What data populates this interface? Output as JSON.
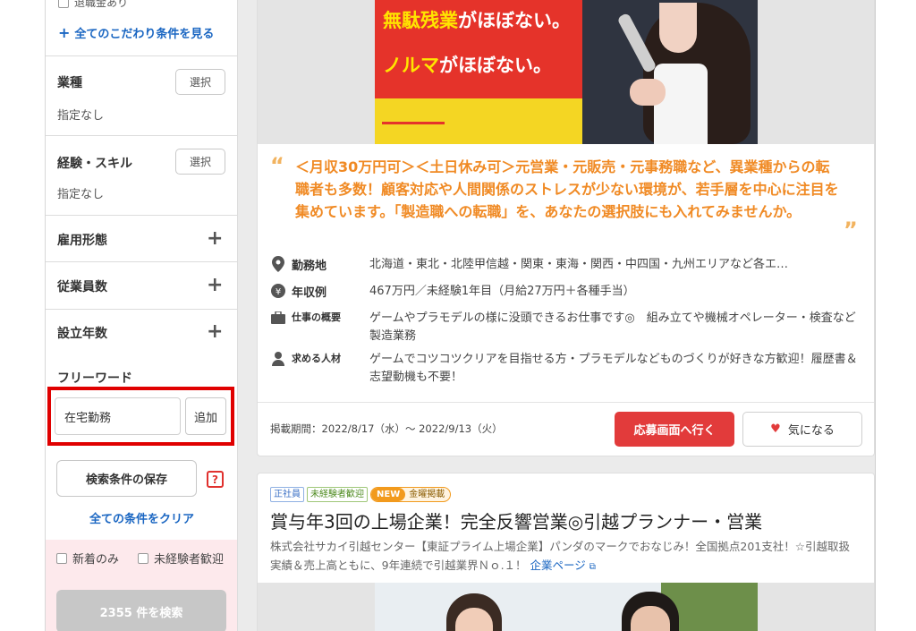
{
  "sidebar": {
    "partial_option": "退職金あり",
    "more_conditions": "全てのこだわり条件を見る",
    "industry": {
      "label": "業種",
      "value": "指定なし",
      "button": "選択"
    },
    "experience": {
      "label": "経験・スキル",
      "value": "指定なし",
      "button": "選択"
    },
    "employment_type": "雇用形態",
    "employees": "従業員数",
    "founded": "設立年数",
    "freeword": {
      "label": "フリーワード",
      "value": "在宅勤務",
      "add": "追加"
    },
    "save": "検索条件の保存",
    "help": "?",
    "clear": "全ての条件をクリア",
    "new_only": "新着のみ",
    "inexperienced": "未経験者歓迎",
    "search_button": "2355 件を検索"
  },
  "card1": {
    "banner_line1_a": "無駄残業",
    "banner_line1_b": "がほぼない。",
    "banner_line2_a": "ノルマ",
    "banner_line2_b": "がほぼない。",
    "catch": "＜月収30万円可＞＜土日休み可＞元営業・元販売・元事務職など、異業種からの転職者も多数！顧客対応や人間関係のストレスが少ない環境が、若手層を中心に注目を集めています。「製造職への転職」を、あなたの選択肢にも入れてみませんか。",
    "location_label": "勤務地",
    "location": "北海道・東北・北陸甲信越・関東・東海・関西・中四国・九州エリアなど各エ…",
    "salary_label": "年収例",
    "salary": "467万円／未経験1年目（月給27万円＋各種手当）",
    "work_label": "仕事の概要",
    "work": "ゲームやプラモデルの様に没頭できるお仕事です◎　組み立てや機械オペレーター・検査など製造業務",
    "person_label": "求める人材",
    "person": "ゲームでコツコツクリアを目指せる方・プラモデルなどものづくりが好きな方歓迎！履歴書＆志望動機も不要！",
    "period": "掲載期間：2022/8/17（水）～ 2022/9/13（火）",
    "apply": "応募画面へ行く",
    "favorite": "気になる"
  },
  "card2": {
    "badge_regular": "正社員",
    "badge_inexperienced": "未経験者歓迎",
    "badge_new": "NEW",
    "badge_friday": "金曜掲載",
    "title": "賞与年3回の上場企業！完全反響営業◎引越プランナー・営業",
    "company": "株式会社サカイ引越センター【東証プライム上場企業】パンダのマークでおなじみ！全国拠点201支社！☆引越取扱実績＆売上高ともに、9年連続で引越業界Ｎｏ.１！",
    "company_link": "企業ページ"
  },
  "colors": {
    "accent_red": "#e23b3b",
    "link_blue": "#1a66c2",
    "catch_orange": "#f08a24",
    "highlight_box": "#e00000"
  }
}
